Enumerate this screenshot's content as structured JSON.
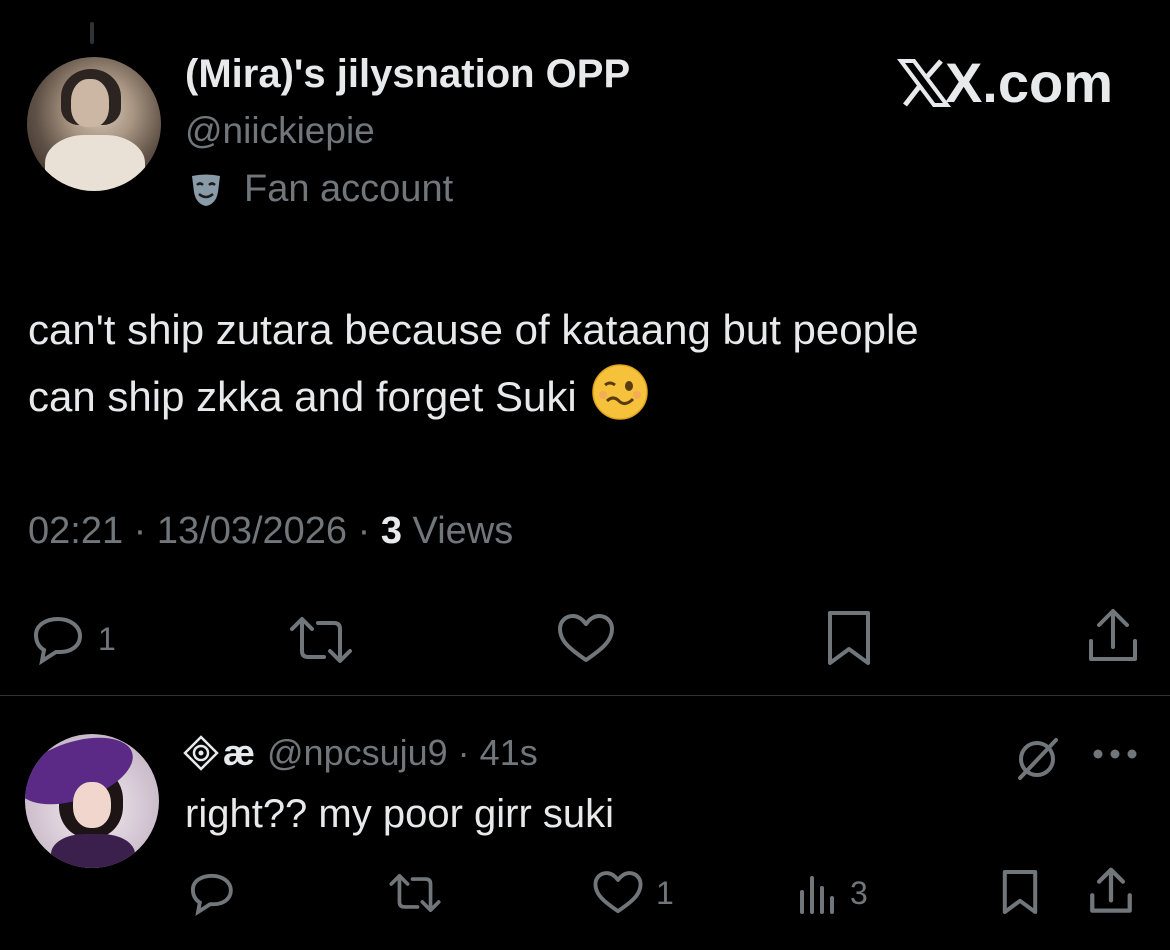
{
  "tweet": {
    "author": {
      "display_name": "(Mira)'s jilysnation OPP",
      "handle": "@niickiepie",
      "affiliation": "Fan account"
    },
    "watermark": "X.com",
    "text_line1": "can't ship zutara because of kataang but people",
    "text_line2": "can ship zkka and forget Suki",
    "emoji": "woozy-face",
    "time": "02:21",
    "date": "13/03/2026",
    "views_count": "3",
    "views_label": "Views",
    "actions": {
      "reply_count": "1",
      "retweet_count": "",
      "like_count": ""
    }
  },
  "reply": {
    "name": "æ",
    "handle": "@npcsuju9",
    "time": "41s",
    "text": "right?? my poor girr suki",
    "actions": {
      "like_count": "1",
      "views_count": "3"
    }
  },
  "colors": {
    "background": "#000000",
    "text_primary": "#e7e9ea",
    "text_secondary": "#71767b",
    "divider": "#2f3336"
  }
}
